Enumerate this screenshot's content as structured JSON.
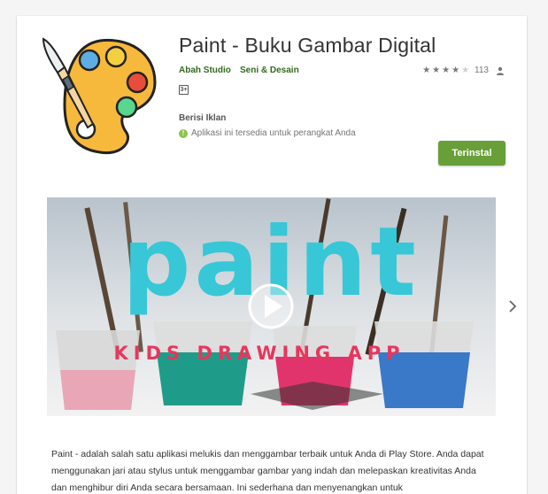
{
  "app": {
    "title": "Paint - Buku Gambar Digital",
    "developer": "Abah Studio",
    "category": "Seni & Desain",
    "rating_value": 4,
    "rating_count": "113",
    "age_rating": "3+",
    "ads_label": "Berisi Iklan",
    "availability": "Aplikasi ini tersedia untuk perangkat Anda",
    "install_label": "Terinstal",
    "icon": "paint-palette-icon"
  },
  "video": {
    "title_text": "paint",
    "subtitle_text": "KIDS DRAWING APP"
  },
  "description": {
    "text": "Paint - adalah salah satu aplikasi melukis dan menggambar terbaik untuk Anda di Play Store. Anda dapat menggunakan jari atau stylus untuk menggambar gambar yang indah dan melepaskan kreativitas Anda dan menghibur diri Anda secara bersamaan. Ini sederhana dan menyenangkan untuk"
  },
  "colors": {
    "brand_green": "#689f38",
    "link_green": "#33691e",
    "video_title": "#38c7d6",
    "video_subtitle": "#e8365c"
  }
}
